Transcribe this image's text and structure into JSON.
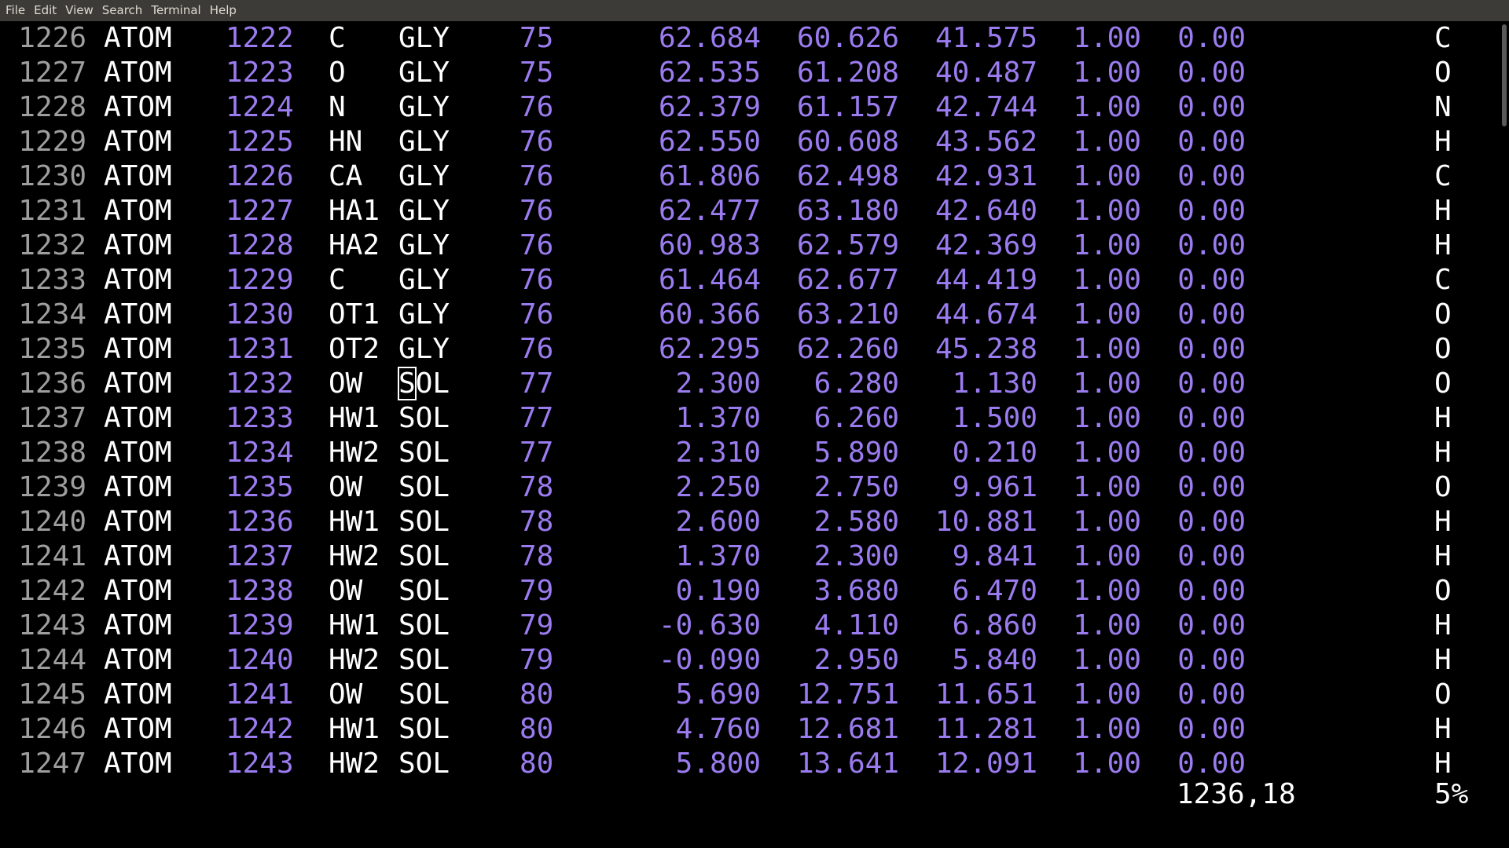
{
  "menubar": {
    "items": [
      "File",
      "Edit",
      "View",
      "Search",
      "Terminal",
      "Help"
    ]
  },
  "rows": [
    {
      "line": "1226",
      "rec": "ATOM",
      "serial": "1222",
      "name": "C",
      "res": "GLY",
      "seq": "75",
      "x": "62.684",
      "y": "60.626",
      "z": "41.575",
      "occ": "1.00",
      "bf": "0.00",
      "elem": "C"
    },
    {
      "line": "1227",
      "rec": "ATOM",
      "serial": "1223",
      "name": "O",
      "res": "GLY",
      "seq": "75",
      "x": "62.535",
      "y": "61.208",
      "z": "40.487",
      "occ": "1.00",
      "bf": "0.00",
      "elem": "O"
    },
    {
      "line": "1228",
      "rec": "ATOM",
      "serial": "1224",
      "name": "N",
      "res": "GLY",
      "seq": "76",
      "x": "62.379",
      "y": "61.157",
      "z": "42.744",
      "occ": "1.00",
      "bf": "0.00",
      "elem": "N"
    },
    {
      "line": "1229",
      "rec": "ATOM",
      "serial": "1225",
      "name": "HN",
      "res": "GLY",
      "seq": "76",
      "x": "62.550",
      "y": "60.608",
      "z": "43.562",
      "occ": "1.00",
      "bf": "0.00",
      "elem": "H"
    },
    {
      "line": "1230",
      "rec": "ATOM",
      "serial": "1226",
      "name": "CA",
      "res": "GLY",
      "seq": "76",
      "x": "61.806",
      "y": "62.498",
      "z": "42.931",
      "occ": "1.00",
      "bf": "0.00",
      "elem": "C"
    },
    {
      "line": "1231",
      "rec": "ATOM",
      "serial": "1227",
      "name": "HA1",
      "res": "GLY",
      "seq": "76",
      "x": "62.477",
      "y": "63.180",
      "z": "42.640",
      "occ": "1.00",
      "bf": "0.00",
      "elem": "H"
    },
    {
      "line": "1232",
      "rec": "ATOM",
      "serial": "1228",
      "name": "HA2",
      "res": "GLY",
      "seq": "76",
      "x": "60.983",
      "y": "62.579",
      "z": "42.369",
      "occ": "1.00",
      "bf": "0.00",
      "elem": "H"
    },
    {
      "line": "1233",
      "rec": "ATOM",
      "serial": "1229",
      "name": "C",
      "res": "GLY",
      "seq": "76",
      "x": "61.464",
      "y": "62.677",
      "z": "44.419",
      "occ": "1.00",
      "bf": "0.00",
      "elem": "C"
    },
    {
      "line": "1234",
      "rec": "ATOM",
      "serial": "1230",
      "name": "OT1",
      "res": "GLY",
      "seq": "76",
      "x": "60.366",
      "y": "63.210",
      "z": "44.674",
      "occ": "1.00",
      "bf": "0.00",
      "elem": "O"
    },
    {
      "line": "1235",
      "rec": "ATOM",
      "serial": "1231",
      "name": "OT2",
      "res": "GLY",
      "seq": "76",
      "x": "62.295",
      "y": "62.260",
      "z": "45.238",
      "occ": "1.00",
      "bf": "0.00",
      "elem": "O"
    },
    {
      "line": "1236",
      "rec": "ATOM",
      "serial": "1232",
      "name": "OW",
      "res": "SOL",
      "seq": "77",
      "x": "2.300",
      "y": "6.280",
      "z": "1.130",
      "occ": "1.00",
      "bf": "0.00",
      "elem": "O"
    },
    {
      "line": "1237",
      "rec": "ATOM",
      "serial": "1233",
      "name": "HW1",
      "res": "SOL",
      "seq": "77",
      "x": "1.370",
      "y": "6.260",
      "z": "1.500",
      "occ": "1.00",
      "bf": "0.00",
      "elem": "H"
    },
    {
      "line": "1238",
      "rec": "ATOM",
      "serial": "1234",
      "name": "HW2",
      "res": "SOL",
      "seq": "77",
      "x": "2.310",
      "y": "5.890",
      "z": "0.210",
      "occ": "1.00",
      "bf": "0.00",
      "elem": "H"
    },
    {
      "line": "1239",
      "rec": "ATOM",
      "serial": "1235",
      "name": "OW",
      "res": "SOL",
      "seq": "78",
      "x": "2.250",
      "y": "2.750",
      "z": "9.961",
      "occ": "1.00",
      "bf": "0.00",
      "elem": "O"
    },
    {
      "line": "1240",
      "rec": "ATOM",
      "serial": "1236",
      "name": "HW1",
      "res": "SOL",
      "seq": "78",
      "x": "2.600",
      "y": "2.580",
      "z": "10.881",
      "occ": "1.00",
      "bf": "0.00",
      "elem": "H"
    },
    {
      "line": "1241",
      "rec": "ATOM",
      "serial": "1237",
      "name": "HW2",
      "res": "SOL",
      "seq": "78",
      "x": "1.370",
      "y": "2.300",
      "z": "9.841",
      "occ": "1.00",
      "bf": "0.00",
      "elem": "H"
    },
    {
      "line": "1242",
      "rec": "ATOM",
      "serial": "1238",
      "name": "OW",
      "res": "SOL",
      "seq": "79",
      "x": "0.190",
      "y": "3.680",
      "z": "6.470",
      "occ": "1.00",
      "bf": "0.00",
      "elem": "O"
    },
    {
      "line": "1243",
      "rec": "ATOM",
      "serial": "1239",
      "name": "HW1",
      "res": "SOL",
      "seq": "79",
      "x": "-0.630",
      "y": "4.110",
      "z": "6.860",
      "occ": "1.00",
      "bf": "0.00",
      "elem": "H"
    },
    {
      "line": "1244",
      "rec": "ATOM",
      "serial": "1240",
      "name": "HW2",
      "res": "SOL",
      "seq": "79",
      "x": "-0.090",
      "y": "2.950",
      "z": "5.840",
      "occ": "1.00",
      "bf": "0.00",
      "elem": "H"
    },
    {
      "line": "1245",
      "rec": "ATOM",
      "serial": "1241",
      "name": "OW",
      "res": "SOL",
      "seq": "80",
      "x": "5.690",
      "y": "12.751",
      "z": "11.651",
      "occ": "1.00",
      "bf": "0.00",
      "elem": "O"
    },
    {
      "line": "1246",
      "rec": "ATOM",
      "serial": "1242",
      "name": "HW1",
      "res": "SOL",
      "seq": "80",
      "x": "4.760",
      "y": "12.681",
      "z": "11.281",
      "occ": "1.00",
      "bf": "0.00",
      "elem": "H"
    },
    {
      "line": "1247",
      "rec": "ATOM",
      "serial": "1243",
      "name": "HW2",
      "res": "SOL",
      "seq": "80",
      "x": "5.800",
      "y": "13.641",
      "z": "12.091",
      "occ": "1.00",
      "bf": "0.00",
      "elem": "H"
    }
  ],
  "cursor": {
    "row_line": "1236",
    "column": 18
  },
  "status": {
    "position": "1236,18",
    "percent": "5%"
  },
  "colors": {
    "background": "#000000",
    "menubar": "#3c3b37",
    "line_number": "#9e9e9e",
    "number": "#9b7cf0",
    "text": "#ffffff"
  }
}
